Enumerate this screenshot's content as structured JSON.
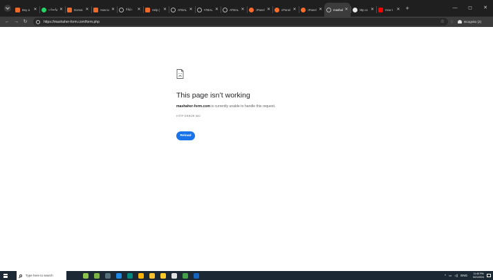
{
  "browser": {
    "tabs": [
      {
        "title": "Buy a",
        "favicon": "orange-square-icon",
        "active": false
      },
      {
        "title": "واتساب",
        "favicon": "whatsapp-icon",
        "active": false
      },
      {
        "title": "Domai",
        "favicon": "orange-square-icon",
        "active": false
      },
      {
        "title": "How to",
        "favicon": "orange-square-icon",
        "active": false
      },
      {
        "title": "دليلالا",
        "favicon": "globe-icon",
        "active": false
      },
      {
        "title": "Help (",
        "favicon": "orange-square-icon",
        "active": false
      },
      {
        "title": "ATBAL",
        "favicon": "globe-icon",
        "active": false
      },
      {
        "title": "ATBAL",
        "favicon": "globe-icon",
        "active": false
      },
      {
        "title": "ATBAL",
        "favicon": "globe-icon",
        "active": false
      },
      {
        "title": "cPanel",
        "favicon": "cpanel-icon",
        "active": false
      },
      {
        "title": "cPanel",
        "favicon": "cpanel-icon",
        "active": false
      },
      {
        "title": "cPanel",
        "favicon": "cpanel-icon",
        "active": false
      },
      {
        "title": "mashal",
        "favicon": "globe-icon",
        "active": true
      },
      {
        "title": "http.cc",
        "favicon": "github-icon",
        "active": false
      },
      {
        "title": "How t",
        "favicon": "youtube-icon",
        "active": false
      }
    ],
    "new_tab": "+",
    "window_controls": {
      "minimize": "—",
      "maximize": "◻",
      "close": "✕"
    },
    "nav": {
      "back": "←",
      "forward": "→",
      "reload": "↻"
    },
    "url": "https://mashaher-form.com/form.php",
    "incognito_label": "Incognito (2)"
  },
  "error_page": {
    "title": "This page isn’t working",
    "host": "mashaher-form.com",
    "description": " is currently unable to handle this request.",
    "code": "HTTP ERROR 500",
    "reload_label": "Reload"
  },
  "taskbar": {
    "search_placeholder": "Type here to search",
    "language": "ENG",
    "time": "11:40 PM",
    "date": "5/21/2024",
    "app_icon_colors": [
      "#8bc34a",
      "#7cb342",
      "#546e7a",
      "#1e88e5",
      "#00897b",
      "#ffb300",
      "#fbc02d",
      "#ffca28",
      "#e0e0e0",
      "#43a047",
      "#1565c0"
    ]
  },
  "colors": {
    "reload_button": "#1a73e8",
    "tab_strip": "#1f1f1f",
    "toolbar": "#3c3c3c",
    "taskbar": "#1c2834"
  }
}
